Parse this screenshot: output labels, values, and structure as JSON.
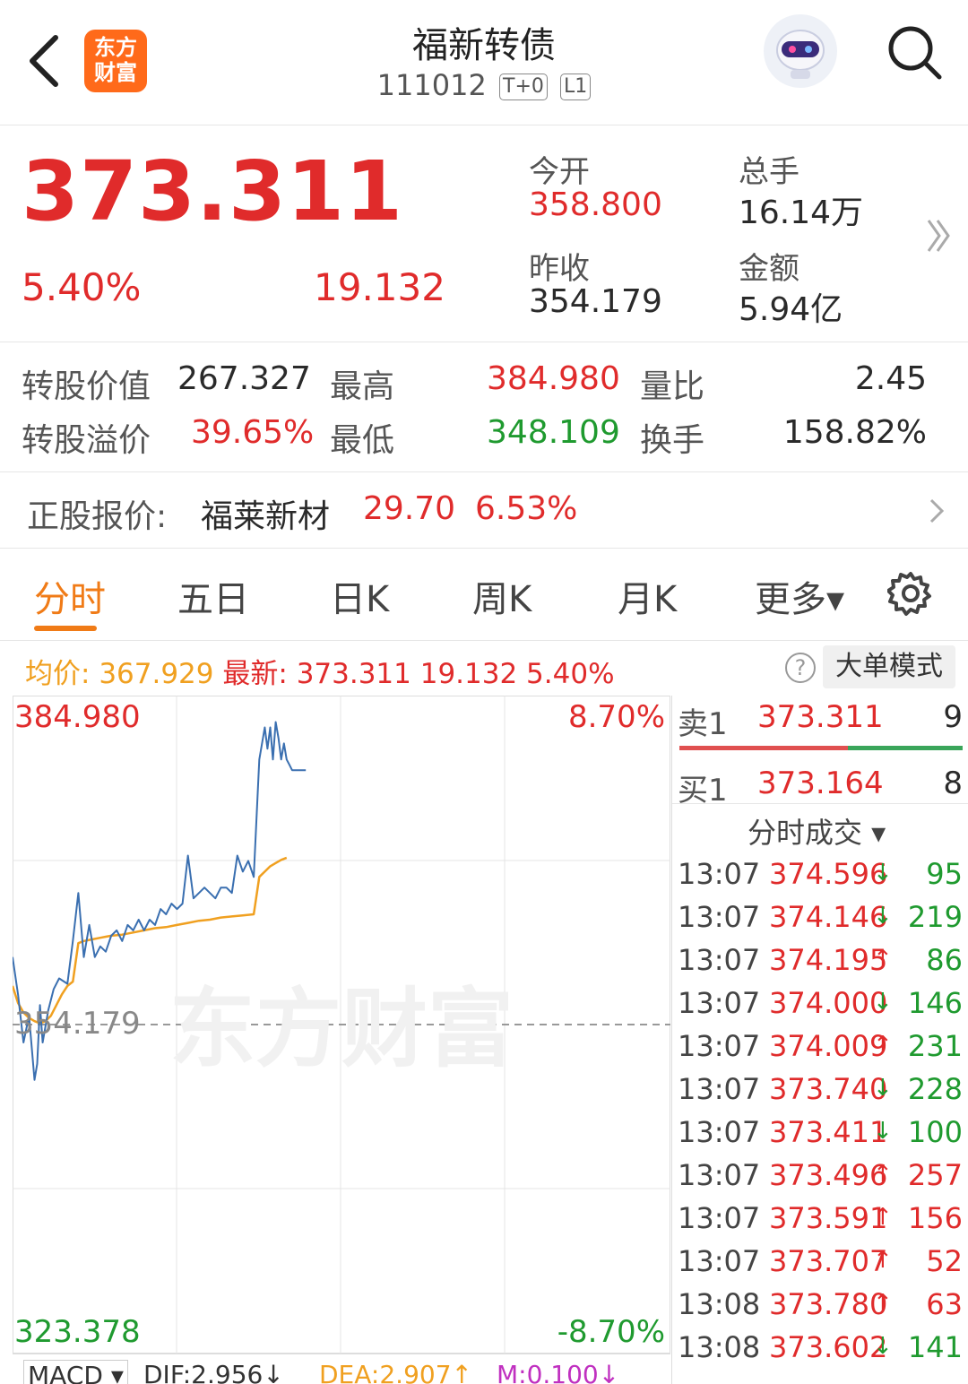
{
  "header": {
    "title": "福新转债",
    "code": "111012",
    "tag_t0": "T+0",
    "tag_level": "L1",
    "logo_line1": "东方",
    "logo_line2": "财富"
  },
  "quote": {
    "price": "373.311",
    "change_pct": "5.40%",
    "change": "19.132",
    "open_label": "今开",
    "open": "358.800",
    "volume_label": "总手",
    "volume": "16.14万",
    "prev_close_label": "昨收",
    "prev_close": "354.179",
    "amount_label": "金额",
    "amount": "5.94亿"
  },
  "bond_stats": {
    "conv_value_label": "转股价值",
    "conv_value": "267.327",
    "high_label": "最高",
    "high": "384.980",
    "vol_ratio_label": "量比",
    "vol_ratio": "2.45",
    "conv_premium_label": "转股溢价",
    "conv_premium": "39.65%",
    "low_label": "最低",
    "low": "348.109",
    "turnover_label": "换手",
    "turnover": "158.82%"
  },
  "stock": {
    "label": "正股报价:",
    "name": "福莱新材",
    "price": "29.70",
    "pct": "6.53%"
  },
  "tabs": [
    {
      "label": "分时",
      "active": true
    },
    {
      "label": "五日"
    },
    {
      "label": "日K"
    },
    {
      "label": "周K"
    },
    {
      "label": "月K"
    },
    {
      "label": "更多▾"
    }
  ],
  "info": {
    "avg_label": "均价:",
    "avg": "367.929",
    "latest_label": "最新:",
    "latest": "373.311 19.132 5.40%",
    "help": "?",
    "big_order": "大单模式"
  },
  "chart_labels": {
    "top_left": "384.980",
    "top_right": "8.70%",
    "mid": "354.179",
    "bottom_left": "323.378",
    "bottom_right": "-8.70%",
    "watermark": "东方财富"
  },
  "chart_data": {
    "type": "line",
    "ylim": [
      323.378,
      384.98
    ],
    "baseline": 354.179,
    "series": [
      {
        "role": "price",
        "color": "#3a6fb0",
        "x": [
          0,
          2,
          4,
          6,
          8,
          9,
          10,
          11,
          13,
          15,
          17,
          20,
          22,
          24,
          26,
          28,
          30,
          32,
          34,
          36,
          38,
          40,
          42,
          44,
          46,
          48,
          50,
          52,
          54,
          56,
          58,
          60,
          62,
          64,
          66,
          68,
          70,
          72,
          74,
          76,
          78,
          80,
          82,
          84,
          86,
          88,
          90,
          92,
          93,
          94,
          95,
          96,
          97,
          98,
          99,
          100,
          101,
          102,
          103,
          104,
          105,
          106,
          107
        ],
        "values": [
          360.5,
          357.0,
          352.5,
          355.0,
          349.0,
          350.5,
          356.0,
          352.5,
          355.5,
          357.5,
          358.5,
          358.0,
          362.0,
          366.5,
          360.5,
          363.5,
          360.5,
          361.5,
          361.0,
          362.5,
          363.0,
          362.0,
          363.5,
          363.0,
          364.0,
          363.0,
          364.0,
          363.5,
          365.0,
          364.5,
          365.5,
          365.0,
          365.5,
          370.0,
          366.0,
          366.5,
          367.0,
          366.5,
          366.0,
          367.0,
          367.0,
          366.5,
          370.0,
          368.5,
          369.5,
          368.0,
          379.0,
          382.0,
          380.0,
          382.0,
          379.0,
          382.5,
          381.0,
          379.0,
          380.5,
          379.0,
          378.5,
          378.0,
          378.0,
          378.0,
          378.0,
          378.0,
          378.0
        ]
      },
      {
        "role": "average",
        "color": "#f0a020",
        "x": [
          0,
          2,
          4,
          6,
          8,
          10,
          12,
          14,
          16,
          18,
          20,
          22,
          24,
          26,
          28,
          30,
          32,
          34,
          36,
          40,
          44,
          48,
          52,
          56,
          60,
          64,
          68,
          72,
          76,
          80,
          84,
          88,
          90,
          92,
          94,
          96,
          98,
          100
        ],
        "values": [
          357.8,
          356.2,
          355.3,
          354.8,
          354.5,
          354.3,
          354.5,
          355.0,
          356.0,
          357.0,
          357.8,
          358.2,
          361.8,
          362.0,
          362.1,
          362.2,
          362.3,
          362.4,
          362.5,
          362.6,
          362.8,
          363.0,
          363.2,
          363.3,
          363.5,
          363.7,
          363.9,
          364.0,
          364.2,
          364.3,
          364.4,
          364.5,
          368.0,
          368.5,
          369.0,
          369.3,
          369.6,
          369.8
        ]
      }
    ]
  },
  "order_book": {
    "sell_label": "卖1",
    "sell_price": "373.311",
    "sell_qty": "9",
    "buy_label": "买1",
    "buy_price": "373.164",
    "buy_qty": "8",
    "trades_header": "分时成交 ▾"
  },
  "trades": [
    {
      "time": "13:07",
      "price": "374.596",
      "dir": "↓",
      "vol": "95"
    },
    {
      "time": "13:07",
      "price": "374.146",
      "dir": "↓",
      "vol": "219"
    },
    {
      "time": "13:07",
      "price": "374.195",
      "dir": "↑",
      "vol": "86"
    },
    {
      "time": "13:07",
      "price": "374.000",
      "dir": "↓",
      "vol": "146"
    },
    {
      "time": "13:07",
      "price": "374.009",
      "dir": "↑",
      "vol": "231"
    },
    {
      "time": "13:07",
      "price": "373.740",
      "dir": "↓",
      "vol": "228"
    },
    {
      "time": "13:07",
      "price": "373.411",
      "dir": "↓",
      "vol": "100"
    },
    {
      "time": "13:07",
      "price": "373.496",
      "dir": "↑",
      "vol": "257"
    },
    {
      "time": "13:07",
      "price": "373.591",
      "dir": "↑",
      "vol": "156"
    },
    {
      "time": "13:07",
      "price": "373.707",
      "dir": "↑",
      "vol": "52"
    },
    {
      "time": "13:08",
      "price": "373.780",
      "dir": "↑",
      "vol": "63"
    },
    {
      "time": "13:08",
      "price": "373.602",
      "dir": "↓",
      "vol": "141"
    }
  ],
  "macd": {
    "label": "MACD ▾",
    "dif": "DIF:2.956↓",
    "dea": "DEA:2.907↑",
    "m": "M:0.100↓"
  },
  "colors": {
    "up": "#e02b2b",
    "down": "#1f9a2f",
    "accent": "#f07b17",
    "price_line": "#3a6fb0",
    "avg_line": "#f0a020"
  },
  "icons": [
    "back-icon",
    "search-icon",
    "robot-avatar-icon",
    "double-chevron-icon",
    "chevron-right-icon",
    "gear-icon",
    "help-icon"
  ]
}
